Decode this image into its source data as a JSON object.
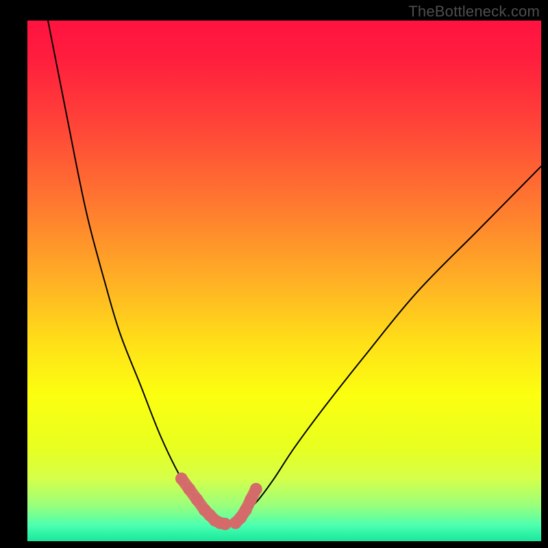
{
  "watermark": "TheBottleneck.com",
  "chart_data": {
    "type": "line",
    "title": "",
    "xlabel": "",
    "ylabel": "",
    "xlim": [
      0,
      100
    ],
    "ylim": [
      0,
      100
    ],
    "grid": false,
    "series": [
      {
        "name": "bottleneck-curve",
        "x": [
          4,
          6,
          8,
          10,
          12,
          15,
          18,
          22,
          26,
          30,
          33,
          34,
          35,
          36,
          37,
          38,
          39,
          40,
          41,
          42,
          43,
          45,
          48,
          52,
          58,
          66,
          76,
          88,
          100
        ],
        "y": [
          100,
          90,
          80,
          70,
          61,
          50,
          40,
          30,
          20,
          12,
          8,
          6,
          5,
          4,
          3.5,
          3.2,
          3.2,
          3.5,
          4,
          5,
          6,
          8,
          12,
          18,
          26,
          36,
          48,
          60,
          72
        ]
      },
      {
        "name": "marker-cluster-left",
        "x": [
          30,
          31.5,
          33,
          34.5,
          35.5,
          36.5,
          37.5,
          38.5
        ],
        "y": [
          12,
          10,
          8,
          6,
          5,
          4,
          3.5,
          3.3
        ]
      },
      {
        "name": "marker-cluster-right",
        "x": [
          40.5,
          41.5,
          42.5,
          43.5,
          44.5
        ],
        "y": [
          3.5,
          4.5,
          6,
          8,
          10
        ]
      }
    ],
    "gradient_stops": [
      {
        "offset": 0.0,
        "color": "#ff1340"
      },
      {
        "offset": 0.07,
        "color": "#ff1d3e"
      },
      {
        "offset": 0.2,
        "color": "#ff4438"
      },
      {
        "offset": 0.35,
        "color": "#ff7830"
      },
      {
        "offset": 0.5,
        "color": "#ffb025"
      },
      {
        "offset": 0.62,
        "color": "#ffe018"
      },
      {
        "offset": 0.72,
        "color": "#fcff10"
      },
      {
        "offset": 0.82,
        "color": "#e8ff20"
      },
      {
        "offset": 0.88,
        "color": "#d5ff4a"
      },
      {
        "offset": 0.93,
        "color": "#9cff7a"
      },
      {
        "offset": 0.97,
        "color": "#4cffb0"
      },
      {
        "offset": 1.0,
        "color": "#18e89c"
      }
    ],
    "curve_color": "#000000",
    "marker_color": "#d46a6a",
    "marker_radius_px": 9
  }
}
